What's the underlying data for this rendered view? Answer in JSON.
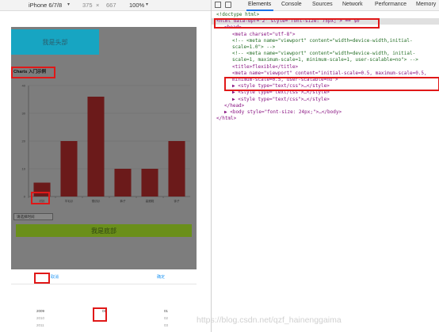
{
  "device_toolbar": {
    "device": "iPhone 6/7/8",
    "width": "375",
    "times": "×",
    "height": "667",
    "zoom": "100%"
  },
  "page": {
    "header": "我是头部",
    "chart_title": "Charts 入门示例",
    "select_value": "请选择时间",
    "footer_bar": "我是底部"
  },
  "chart_data": {
    "type": "bar",
    "categories": [
      "衬衫",
      "羊毛衫",
      "雪纺衫",
      "裤子",
      "高跟鞋",
      "袜子"
    ],
    "values": [
      5,
      20,
      36,
      10,
      10,
      20
    ],
    "ylim": [
      0,
      40
    ],
    "yticks": [
      "0",
      "10",
      "20",
      "30",
      "40"
    ],
    "bar_color": "#6b1a1a"
  },
  "picker": {
    "cancel": "取消",
    "confirm": "确定",
    "rows": [
      {
        "year": "2009",
        "day": "01"
      },
      {
        "year": "2010",
        "day": "02"
      },
      {
        "year": "2011",
        "day": "03"
      }
    ]
  },
  "devtools": {
    "tabs": [
      "Elements",
      "Console",
      "Sources",
      "Network",
      "Performance",
      "Memory"
    ],
    "lines": [
      {
        "indent": 0,
        "text": "<!doctype html>",
        "kind": "cmt"
      },
      {
        "indent": 0,
        "text": "<html data-dpr=\"2\" style=\"font-size: 75px;\"> == $0",
        "kind": "tag"
      },
      {
        "indent": 1,
        "text": "<head>",
        "kind": "tag"
      },
      {
        "indent": 2,
        "text": "<meta charset=\"utf-8\">",
        "kind": "tag"
      },
      {
        "indent": 2,
        "text": "<!-- <meta name=\"viewport\" content=\"width=device-width,initial-",
        "kind": "cmt"
      },
      {
        "indent": 2,
        "text": "scale=1.0\"> -->",
        "kind": "cmt"
      },
      {
        "indent": 2,
        "text": "<!-- <meta name=\"viewport\" content=\"width=device-width, initial-",
        "kind": "cmt"
      },
      {
        "indent": 2,
        "text": "scale=1, maximum-scale=1, minimum-scale=1, user-scalable=no\"> -->",
        "kind": "cmt"
      },
      {
        "indent": 2,
        "text": "<title>flexible</title>",
        "kind": "tag"
      },
      {
        "indent": 2,
        "text": "<meta name=\"viewport\" content=\"initial-scale=0.5, maximum-scale=0.5,",
        "kind": "tag"
      },
      {
        "indent": 2,
        "text": "minimum-scale=0.5, user-scalable=no\">",
        "kind": "tag"
      },
      {
        "indent": 2,
        "text": "▶ <style type=\"text/css\">…</style>",
        "kind": "tag"
      },
      {
        "indent": 2,
        "text": "▶ <style type=\"text/css\">…</style>",
        "kind": "tag"
      },
      {
        "indent": 2,
        "text": "▶ <style type=\"text/css\">…</style>",
        "kind": "tag"
      },
      {
        "indent": 1,
        "text": "</head>",
        "kind": "tag"
      },
      {
        "indent": 1,
        "text": "▶ <body style=\"font-size: 24px;\">…</body>",
        "kind": "tag"
      },
      {
        "indent": 0,
        "text": "</html>",
        "kind": "tag"
      }
    ]
  },
  "watermark": "https://blog.csdn.net/qzf_hainenggaima"
}
